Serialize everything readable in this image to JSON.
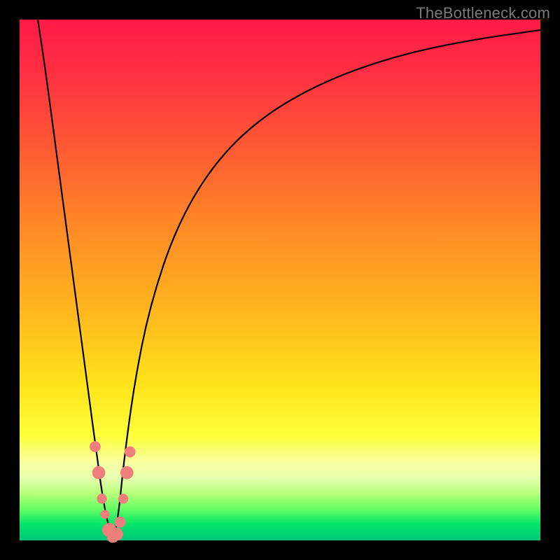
{
  "watermark": "TheBottleneck.com",
  "colors": {
    "frame_bg": "#000000",
    "curve_stroke": "#000000",
    "marker_fill": "#ef7f7b",
    "marker_stroke": "#e06b66"
  },
  "chart_data": {
    "type": "line",
    "title": "",
    "xlabel": "",
    "ylabel": "",
    "xlim": [
      0,
      100
    ],
    "ylim": [
      0,
      100
    ],
    "series": [
      {
        "name": "left-branch",
        "x": [
          3.5,
          5,
          7,
          9,
          11,
          13,
          15,
          16,
          17,
          18
        ],
        "y": [
          100,
          90,
          75,
          60,
          45,
          30,
          15,
          8,
          3,
          0
        ]
      },
      {
        "name": "right-branch",
        "x": [
          18,
          19,
          20,
          22,
          25,
          30,
          37,
          46,
          58,
          72,
          86,
          100
        ],
        "y": [
          0,
          5,
          15,
          30,
          45,
          60,
          72,
          81,
          88,
          93,
          96,
          98
        ]
      }
    ],
    "markers": {
      "name": "highlight-points",
      "points": [
        {
          "x": 14.5,
          "y": 18,
          "r": 1.1
        },
        {
          "x": 15.2,
          "y": 13,
          "r": 1.3
        },
        {
          "x": 15.8,
          "y": 8,
          "r": 1.0
        },
        {
          "x": 16.4,
          "y": 5,
          "r": 0.9
        },
        {
          "x": 17.2,
          "y": 2,
          "r": 1.4
        },
        {
          "x": 17.9,
          "y": 0.7,
          "r": 1.2
        },
        {
          "x": 18.6,
          "y": 1.2,
          "r": 1.3
        },
        {
          "x": 19.3,
          "y": 3.5,
          "r": 1.1
        },
        {
          "x": 19.9,
          "y": 8,
          "r": 1.0
        },
        {
          "x": 20.6,
          "y": 13,
          "r": 1.3
        },
        {
          "x": 21.2,
          "y": 17,
          "r": 1.1
        }
      ]
    }
  }
}
